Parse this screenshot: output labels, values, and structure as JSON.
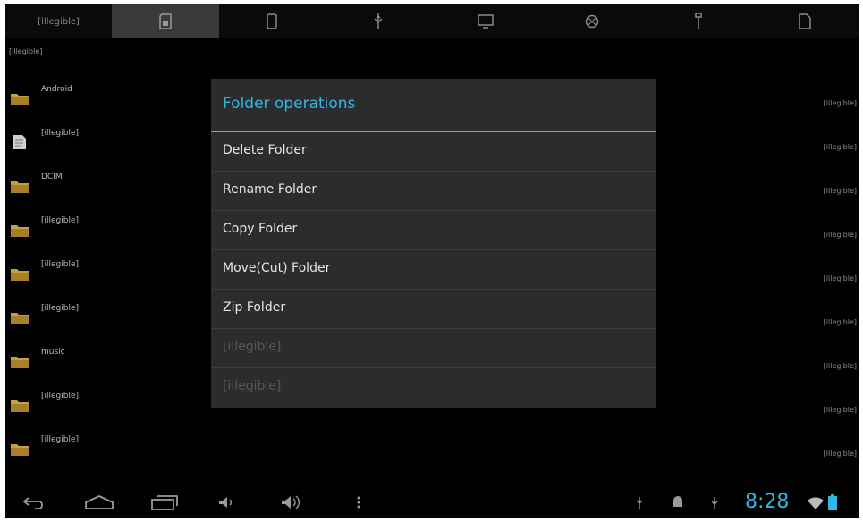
{
  "colors": {
    "accent": "#33b5e5",
    "folder": "#c8a040",
    "background": "#000000",
    "dialog": "#2b2c2e"
  },
  "top_tabs": [
    {
      "label": "[illegible]",
      "icon": "home-icon",
      "active": false
    },
    {
      "label": "",
      "icon": "sdcard-icon",
      "active": true
    },
    {
      "label": "",
      "icon": "phone-icon",
      "active": false
    },
    {
      "label": "",
      "icon": "usb-icon",
      "active": false
    },
    {
      "label": "",
      "icon": "monitor-icon",
      "active": false
    },
    {
      "label": "",
      "icon": "globe-icon",
      "active": false
    },
    {
      "label": "",
      "icon": "wrench-icon",
      "active": false
    },
    {
      "label": "",
      "icon": "document-icon",
      "active": false
    }
  ],
  "path": "[illegible]",
  "files": [
    {
      "name": "Android",
      "type": "folder",
      "info": "[illegible]"
    },
    {
      "name": "[illegible]",
      "type": "file",
      "info": "[illegible]"
    },
    {
      "name": "DCIM",
      "type": "folder",
      "info": "[illegible]"
    },
    {
      "name": "[illegible]",
      "type": "folder",
      "info": "[illegible]"
    },
    {
      "name": "[illegible]",
      "type": "folder",
      "info": "[illegible]"
    },
    {
      "name": "[illegible]",
      "type": "folder",
      "info": "[illegible]"
    },
    {
      "name": "music",
      "type": "folder",
      "info": "[illegible]"
    },
    {
      "name": "[illegible]",
      "type": "folder",
      "info": "[illegible]"
    },
    {
      "name": "[illegible]",
      "type": "folder",
      "info": "[illegible]"
    }
  ],
  "dialog": {
    "title": "Folder operations",
    "options": [
      {
        "label": "Delete Folder",
        "enabled": true
      },
      {
        "label": "Rename Folder",
        "enabled": true
      },
      {
        "label": "Copy Folder",
        "enabled": true
      },
      {
        "label": "Move(Cut) Folder",
        "enabled": true
      },
      {
        "label": "Zip Folder",
        "enabled": true
      },
      {
        "label": "[illegible]",
        "enabled": false
      },
      {
        "label": "[illegible]",
        "enabled": false
      }
    ]
  },
  "navbar": {
    "buttons": [
      "back-icon",
      "home-icon",
      "recent-apps-icon",
      "volume-down-icon",
      "volume-up-icon",
      "menu-icon"
    ],
    "status_icons": [
      "usb-debug-icon",
      "android-icon",
      "usb-icon",
      "wifi-icon",
      "battery-icon"
    ],
    "clock": "8:28"
  }
}
